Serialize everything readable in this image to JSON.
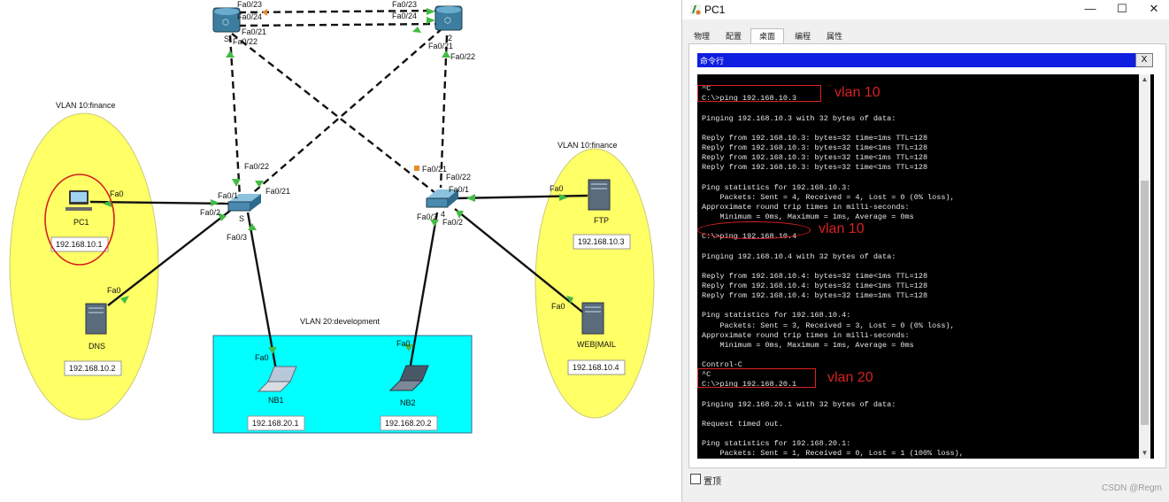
{
  "topology": {
    "zones": {
      "finance_left": "VLAN 10:finance",
      "finance_right": "VLAN 10:finance",
      "development": "VLAN 20:development"
    },
    "devices": {
      "pc1": {
        "name": "PC1",
        "ip": "192.168.10.1",
        "port": "Fa0"
      },
      "dns": {
        "name": "DNS",
        "ip": "192.168.10.2",
        "port": "Fa0"
      },
      "ftp": {
        "name": "FTP",
        "ip": "192.168.10.3",
        "port": "Fa0"
      },
      "webmail": {
        "name": "WEB|MAIL",
        "ip": "192.168.10.4",
        "port": "Fa0"
      },
      "nb1": {
        "name": "NB1",
        "ip": "192.168.20.1",
        "port": "Fa0"
      },
      "nb2": {
        "name": "NB2",
        "ip": "192.168.20.2",
        "port": "Fa0"
      },
      "s1": {
        "name": "S"
      },
      "s2": {
        "name": "2"
      },
      "s3": {
        "name": "S"
      },
      "s4": {
        "name": "4"
      }
    },
    "ports": {
      "s1_fa023": "Fa0/23",
      "s1_fa024": "Fa0/24",
      "s1_fa021": "Fa0/21",
      "s1_fa022": "Fa0/22",
      "s2_fa023": "Fa0/23",
      "s2_fa024": "Fa0/24",
      "s2_fa021": "Fa0/21",
      "s2_fa022": "Fa0/22",
      "s3_fa022": "Fa0/22",
      "s3_fa021": "Fa0/21",
      "s3_fa01": "Fa0/1",
      "s3_fa02": "Fa0/2",
      "s3_fa03": "Fa0/3",
      "s4_fa021": "Fa0/21",
      "s4_fa022": "Fa0/22",
      "s4_fa01": "Fa0/1",
      "s4_fa03": "Fa0/3",
      "s4_fa02": "Fa0/2"
    }
  },
  "window": {
    "title": "PC1",
    "tabs": [
      "物理",
      "配置",
      "桌面",
      "编程",
      "属性"
    ],
    "active_tab": 2,
    "command_title": "命令行",
    "close_glyph": "X",
    "console_lines": [
      "",
      "^C",
      "C:\\>ping 192.168.10.3",
      "",
      "Pinging 192.168.10.3 with 32 bytes of data:",
      "",
      "Reply from 192.168.10.3: bytes=32 time=1ms TTL=128",
      "Reply from 192.168.10.3: bytes=32 time<1ms TTL=128",
      "Reply from 192.168.10.3: bytes=32 time<1ms TTL=128",
      "Reply from 192.168.10.3: bytes=32 time<1ms TTL=128",
      "",
      "Ping statistics for 192.168.10.3:",
      "    Packets: Sent = 4, Received = 4, Lost = 0 (0% loss),",
      "Approximate round trip times in milli-seconds:",
      "    Minimum = 0ms, Maximum = 1ms, Average = 0ms",
      "",
      "C:\\>ping 192.168.10.4",
      "",
      "Pinging 192.168.10.4 with 32 bytes of data:",
      "",
      "Reply from 192.168.10.4: bytes=32 time<1ms TTL=128",
      "Reply from 192.168.10.4: bytes=32 time<1ms TTL=128",
      "Reply from 192.168.10.4: bytes=32 time=1ms TTL=128",
      "",
      "Ping statistics for 192.168.10.4:",
      "    Packets: Sent = 3, Received = 3, Lost = 0 (0% loss),",
      "Approximate round trip times in milli-seconds:",
      "    Minimum = 0ms, Maximum = 1ms, Average = 0ms",
      "",
      "Control-C",
      "^C",
      "C:\\>ping 192.168.20.1",
      "",
      "Pinging 192.168.20.1 with 32 bytes of data:",
      "",
      "Request timed out.",
      "",
      "Ping statistics for 192.168.20.1:",
      "    Packets: Sent = 1, Received = 0, Lost = 1 (100% loss),"
    ],
    "annotations": {
      "vlan_a": "vlan 10",
      "vlan_b": "vlan 10",
      "vlan_c": "vlan 20"
    },
    "always_on_top_label": "置顶",
    "always_on_top_checked": false,
    "watermark": "CSDN @Regm"
  },
  "colors": {
    "finance_zone": "#ffff66",
    "development_zone": "#00ffff",
    "link_up": "#44bb44",
    "cmd_bar": "#0f1ee0",
    "annotation": "#e02020"
  }
}
